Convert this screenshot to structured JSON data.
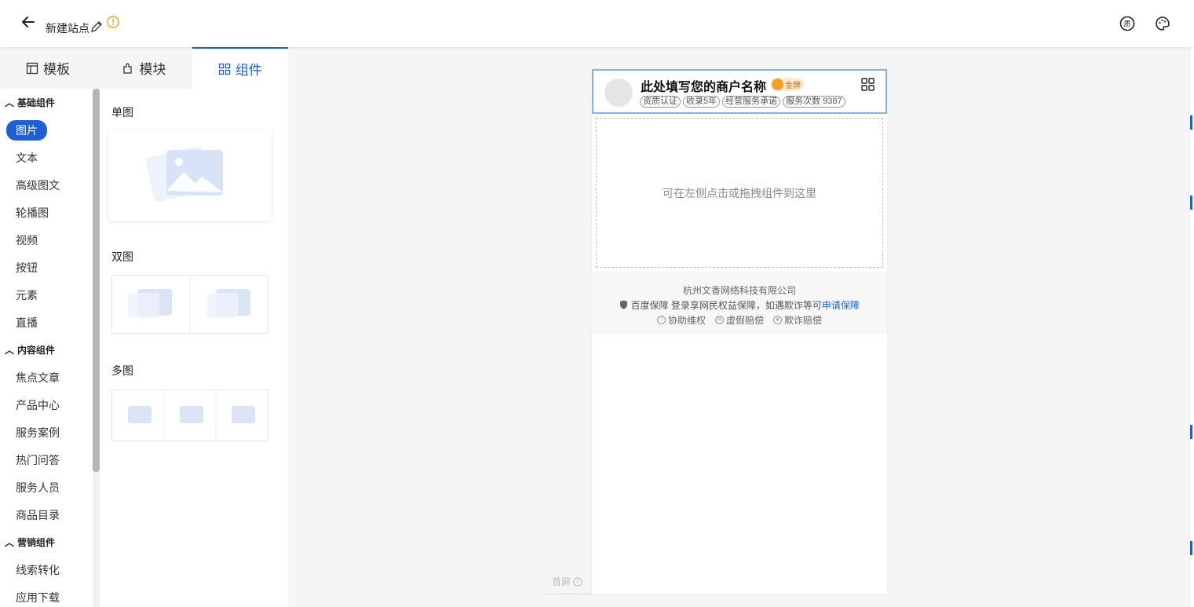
{
  "topbar": {
    "title": "新建站点"
  },
  "tabs": [
    {
      "label": "模板"
    },
    {
      "label": "模块"
    },
    {
      "label": "组件"
    }
  ],
  "categories": {
    "basic": {
      "label": "基础组件",
      "items": [
        "图片",
        "文本",
        "高级图文",
        "轮播图",
        "视频",
        "按钮",
        "元素",
        "直播"
      ]
    },
    "content": {
      "label": "内容组件",
      "items": [
        "焦点文章",
        "产品中心",
        "服务案例",
        "热门问答",
        "服务人员",
        "商品目录"
      ]
    },
    "marketing": {
      "label": "营销组件",
      "items": [
        "线索转化",
        "应用下载"
      ]
    }
  },
  "components": {
    "single": "单图",
    "double": "双图",
    "multi": "多图"
  },
  "phone": {
    "merchant_name": "此处填写您的商户名称",
    "badge": "金牌",
    "tags": [
      "资质认证",
      "收录5年",
      "经营服务承诺",
      "服务次数 9387"
    ],
    "drop_hint": "可在左侧点击或拖拽组件到这里",
    "company": "杭州文香网络科技有限公司",
    "guarantee_text": "百度保障 登录享网民权益保障，如遇欺诈等可",
    "guarantee_link": "申请保障",
    "badges": [
      "协助维权",
      "虚假赔偿",
      "欺诈赔偿"
    ]
  },
  "first_screen": "首屏",
  "colors": {
    "accent": "#1f5fd6",
    "header_border": "#86b1f0"
  }
}
